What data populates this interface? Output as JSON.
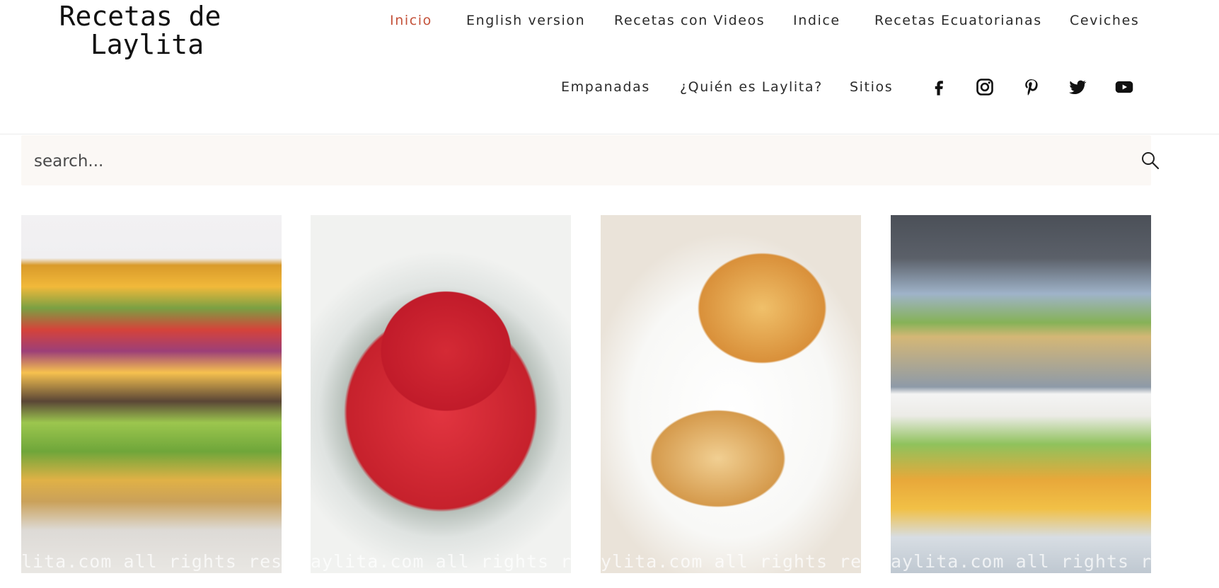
{
  "header": {
    "logo_line1": "Recetas de",
    "logo_line2": "Laylita",
    "nav": [
      {
        "label": "Inicio",
        "active": true
      },
      {
        "label": "English version"
      },
      {
        "label": "Recetas con Videos"
      },
      {
        "label": "Indice"
      },
      {
        "label": "Recetas Ecuatorianas"
      },
      {
        "label": "Ceviches"
      },
      {
        "label": "Empanadas"
      },
      {
        "label": "¿Quién es Laylita?"
      },
      {
        "label": "Sitios"
      }
    ],
    "social": [
      "facebook-icon",
      "instagram-icon",
      "pinterest-icon",
      "twitter-icon",
      "youtube-icon"
    ],
    "accent_color": "#c4523a"
  },
  "search": {
    "placeholder": "search...",
    "value": ""
  },
  "cards": [
    {
      "photo": "patacon-burger",
      "watermark": "lita.com all rights rese"
    },
    {
      "photo": "strawberry-jam",
      "watermark": "aylita.com all rights res"
    },
    {
      "photo": "croissants",
      "watermark": "ylita.com all rights rese"
    },
    {
      "photo": "ecuadorian-appetizers",
      "watermark": "aylita.com all rights res"
    }
  ]
}
